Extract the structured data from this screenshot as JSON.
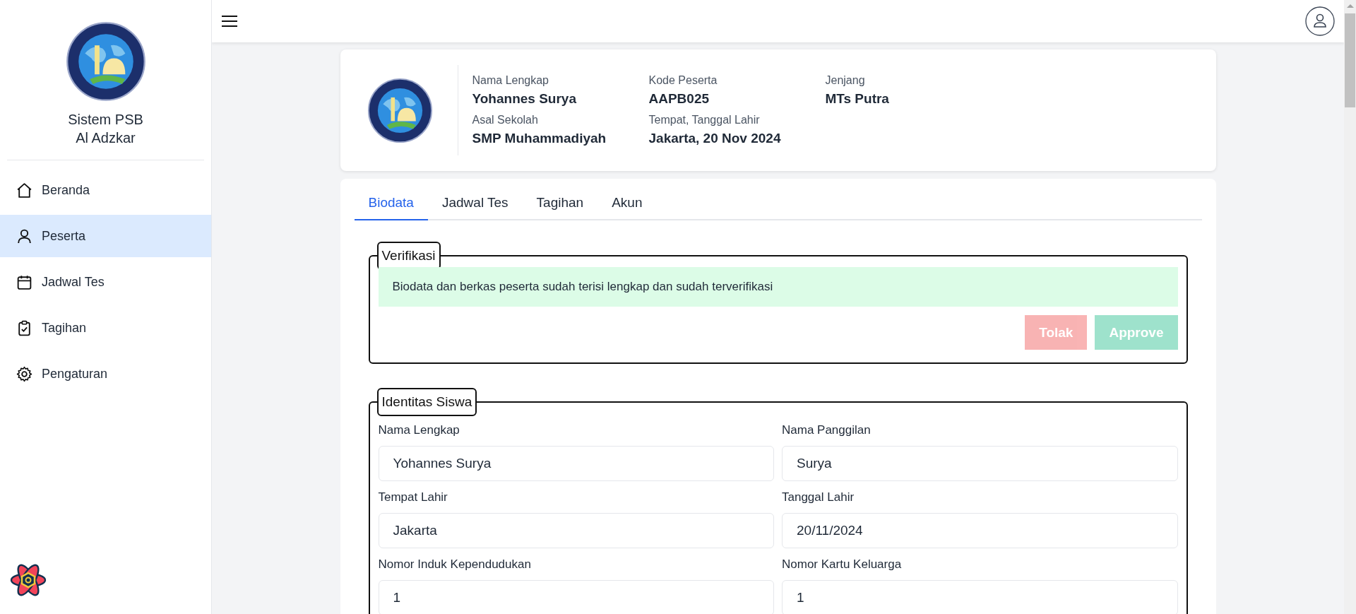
{
  "sidebar": {
    "title_lines": [
      "Sistem PSB",
      "Al Adzkar"
    ],
    "items": [
      {
        "label": "Beranda",
        "selected": false
      },
      {
        "label": "Peserta",
        "selected": true
      },
      {
        "label": "Jadwal Tes",
        "selected": false
      },
      {
        "label": "Tagihan",
        "selected": false
      },
      {
        "label": "Pengaturan",
        "selected": false
      }
    ]
  },
  "profile": {
    "fields": [
      {
        "label": "Nama Lengkap",
        "value": "Yohannes Surya"
      },
      {
        "label": "Kode Peserta",
        "value": "AAPB025"
      },
      {
        "label": "Jenjang",
        "value": "MTs Putra"
      },
      {
        "label": "Asal Sekolah",
        "value": "SMP Muhammadiyah"
      },
      {
        "label": "Tempat, Tanggal Lahir",
        "value": "Jakarta, 20 Nov 2024"
      }
    ]
  },
  "tabs": [
    {
      "label": "Biodata",
      "selected": true
    },
    {
      "label": "Jadwal Tes",
      "selected": false
    },
    {
      "label": "Tagihan",
      "selected": false
    },
    {
      "label": "Akun",
      "selected": false
    }
  ],
  "verification": {
    "title": "Verifikasi",
    "message": "Biodata dan berkas peserta sudah terisi lengkap dan sudah terverifikasi",
    "buttons": [
      {
        "label": "Tolak",
        "kind": "reject",
        "disabled": true
      },
      {
        "label": "Approve",
        "kind": "approve",
        "disabled": true
      }
    ]
  },
  "identity": {
    "title": "Identitas Siswa",
    "fields": [
      {
        "label": "Nama Lengkap",
        "value": "Yohannes Surya"
      },
      {
        "label": "Nama Panggilan",
        "value": "Surya"
      },
      {
        "label": "Tempat Lahir",
        "value": "Jakarta"
      },
      {
        "label": "Tanggal Lahir",
        "value": "20/11/2024"
      },
      {
        "label": "Nomor Induk Kependudukan",
        "value": "1"
      },
      {
        "label": "Nomor Kartu Keluarga",
        "value": "1"
      }
    ]
  }
}
